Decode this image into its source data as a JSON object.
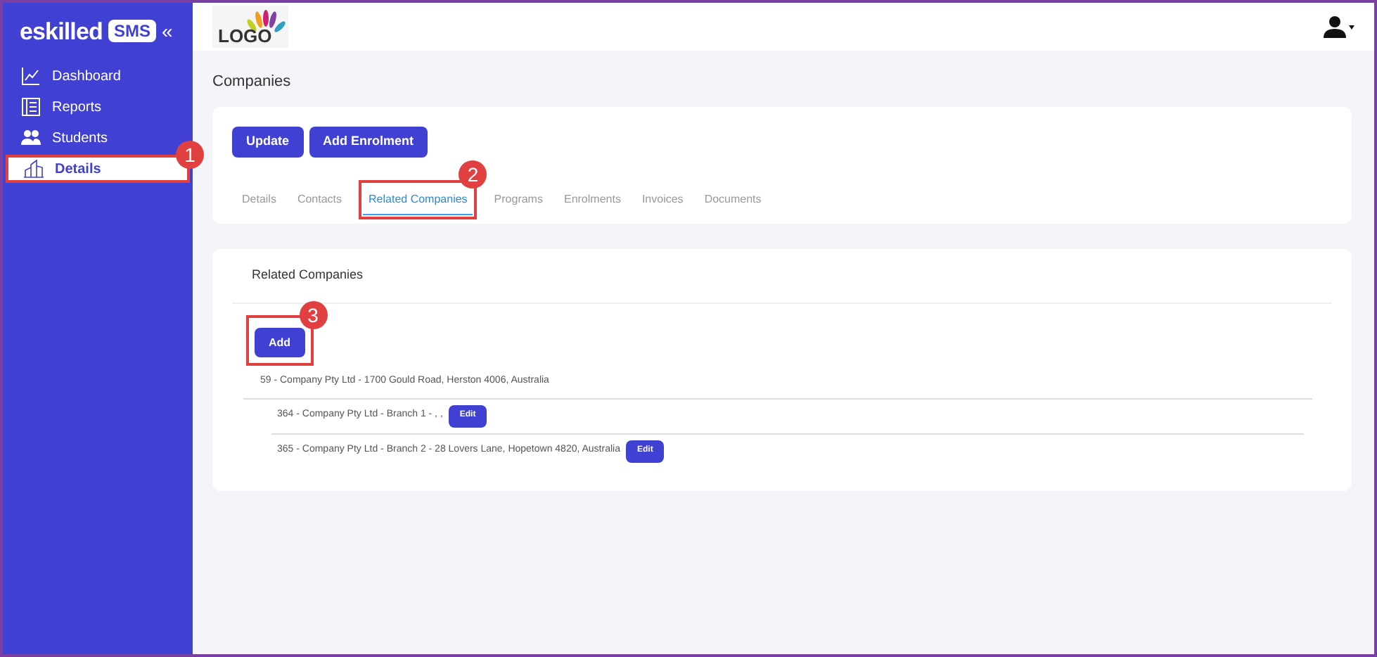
{
  "brand": {
    "name": "skilled",
    "initial": "e",
    "badge": "SMS",
    "collapse": "«"
  },
  "sidebar": {
    "items": [
      {
        "label": "Dashboard",
        "kind": "chart",
        "selected": false
      },
      {
        "label": "Reports",
        "kind": "report",
        "selected": false
      },
      {
        "label": "Students",
        "kind": "users",
        "selected": false
      },
      {
        "label": "Details",
        "kind": "building",
        "selected": true,
        "callout": "1"
      }
    ]
  },
  "topbar": {
    "logo": "LOGO"
  },
  "page": {
    "title": "Companies"
  },
  "actions": [
    "Update",
    "Add Enrolment"
  ],
  "tabs": [
    {
      "label": "Details",
      "selected": false
    },
    {
      "label": "Contacts",
      "selected": false
    },
    {
      "label": "Related Companies",
      "selected": true,
      "callout": "2"
    },
    {
      "label": "Programs",
      "selected": false
    },
    {
      "label": "Enrolments",
      "selected": false
    },
    {
      "label": "Invoices",
      "selected": false
    },
    {
      "label": "Documents",
      "selected": false
    }
  ],
  "related": {
    "title": "Related Companies",
    "add_button": "Add",
    "add_callout": "3",
    "parent": "59 - Company Pty Ltd - 1700 Gould Road, Herston 4006, Australia",
    "children": [
      {
        "text": "364 - Company Pty Ltd - Branch 1 - , ,",
        "button": "Edit"
      },
      {
        "text": "365 - Company Pty Ltd - Branch 2 - 28 Lovers Lane, Hopetown 4820, Australia",
        "button": "Edit"
      }
    ]
  }
}
